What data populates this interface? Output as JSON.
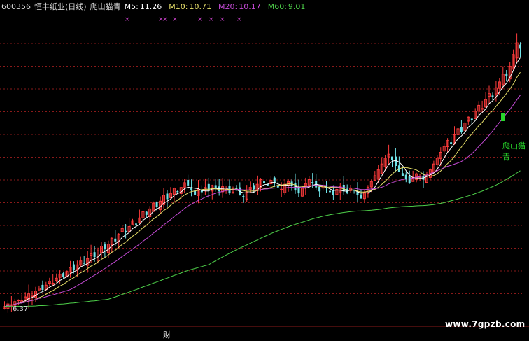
{
  "header": {
    "code": "600356",
    "name": "恒丰纸业(日线)",
    "indicator": "爬山猫青",
    "ma5_label": "M5:",
    "ma5_value": "11.26",
    "ma10_label": "M10:",
    "ma10_value": "10.71",
    "ma20_label": "M20:",
    "ma20_value": "10.17",
    "ma60_label": "M60:",
    "ma60_value": "9.01"
  },
  "markers": [
    "x",
    "x",
    "x",
    "x",
    "x",
    "x",
    "x",
    "x"
  ],
  "min_price_label": "6.37",
  "finance_label": "财",
  "signal_label": "爬山猫青",
  "watermark": "www.7gpzb.com",
  "colors": {
    "background": "#000000",
    "up": "#ff3b3b",
    "down": "#6fe3e8",
    "ma5": "#ffffff",
    "ma10": "#e8e06a",
    "ma20": "#c54bd6",
    "ma60": "#4ed04a",
    "grid": "#8a1a1a",
    "signal": "#27d52a",
    "marker": "#cc44cc"
  },
  "chart_data": {
    "type": "candlestick",
    "count": 150,
    "closes": [
      6.45,
      6.52,
      6.5,
      6.58,
      6.62,
      6.6,
      6.7,
      6.78,
      6.74,
      6.85,
      6.92,
      6.88,
      7.0,
      7.1,
      7.05,
      7.18,
      7.28,
      7.22,
      7.35,
      7.45,
      7.4,
      7.52,
      7.62,
      7.55,
      7.68,
      7.8,
      7.72,
      7.88,
      8.0,
      7.92,
      8.05,
      8.2,
      8.12,
      8.3,
      8.45,
      8.35,
      8.5,
      8.65,
      8.55,
      8.72,
      8.88,
      8.8,
      8.95,
      9.1,
      9.0,
      9.15,
      9.3,
      9.2,
      9.35,
      9.48,
      9.38,
      9.5,
      9.62,
      9.55,
      9.42,
      9.3,
      9.45,
      9.38,
      9.5,
      9.42,
      9.55,
      9.48,
      9.4,
      9.52,
      9.45,
      9.35,
      9.48,
      9.42,
      9.3,
      9.25,
      9.38,
      9.5,
      9.45,
      9.58,
      9.7,
      9.62,
      9.55,
      9.68,
      9.6,
      9.5,
      9.45,
      9.58,
      9.65,
      9.55,
      9.42,
      9.35,
      9.48,
      9.6,
      9.7,
      9.62,
      9.5,
      9.4,
      9.55,
      9.48,
      9.38,
      9.3,
      9.45,
      9.52,
      9.4,
      9.35,
      9.48,
      9.42,
      9.3,
      9.22,
      9.38,
      9.5,
      9.65,
      9.8,
      9.95,
      10.1,
      10.25,
      10.35,
      10.2,
      10.05,
      9.9,
      9.8,
      9.7,
      9.62,
      9.75,
      9.85,
      9.78,
      9.7,
      9.82,
      9.95,
      10.1,
      10.25,
      10.4,
      10.55,
      10.7,
      10.62,
      10.85,
      11.0,
      10.92,
      11.15,
      11.3,
      11.22,
      11.45,
      11.6,
      11.52,
      11.75,
      11.9,
      11.82,
      12.05,
      12.2,
      12.4,
      12.35,
      12.6,
      12.9,
      13.2,
      13.05
    ],
    "price_range": [
      6.2,
      13.9
    ],
    "ma_periods": [
      5,
      10,
      20,
      60
    ]
  }
}
